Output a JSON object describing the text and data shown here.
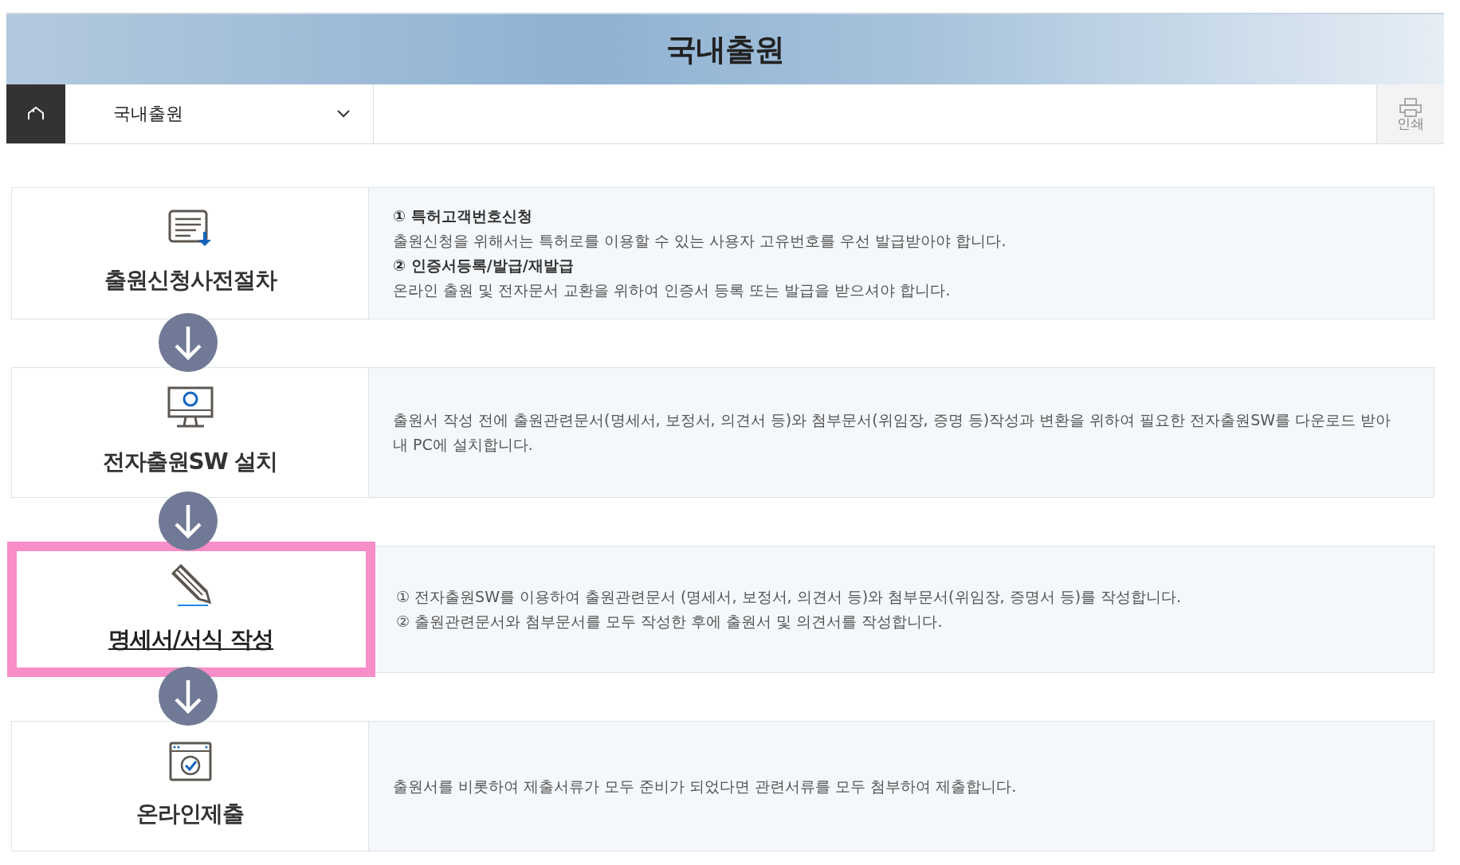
{
  "page_title": "국내출원",
  "nav": {
    "dropdown": "국내출원",
    "print_label": "인쇄"
  },
  "steps": [
    {
      "title": "출원신청사전절차",
      "selected": false,
      "lines": [
        {
          "kind": "heading",
          "text": "① 특허고객번호신청"
        },
        {
          "kind": "text",
          "text": "출원신청을 위해서는 특허로를 이용할 수 있는 사용자 고유번호를 우선 발급받아야 합니다."
        },
        {
          "kind": "heading",
          "text": "② 인증서등록/발급/재발급"
        },
        {
          "kind": "text",
          "text": "온라인 출원 및 전자문서 교환을 위하여 인증서 등록 또는 발급을 받으셔야 합니다."
        }
      ]
    },
    {
      "title": "전자출원SW 설치",
      "selected": false,
      "lines": [
        {
          "kind": "text",
          "text": "출원서 작성 전에 출원관련문서(명세서, 보정서, 의견서 등)와 첨부문서(위임장, 증명 등)작성과 변환을 위하여 필요한 전자출원SW를 다운로드 받아 내 PC에 설치합니다."
        }
      ]
    },
    {
      "title": "명세서/서식 작성",
      "selected": true,
      "lines": [
        {
          "kind": "text",
          "text": "① 전자출원SW를 이용하여 출원관련문서 (명세서, 보정서, 의견서 등)와 첨부문서(위임장, 증명서 등)를 작성합니다."
        },
        {
          "kind": "text",
          "text": "② 출원관련문서와 첨부문서를 모두 작성한 후에 출원서 및 의견서를 작성합니다."
        }
      ]
    },
    {
      "title": "온라인제출",
      "selected": false,
      "lines": [
        {
          "kind": "text",
          "text": "출원서를 비롯하여 제출서류가 모두 준비가 되었다면 관련서류를 모두 첨부하여 제출합니다."
        }
      ]
    }
  ]
}
